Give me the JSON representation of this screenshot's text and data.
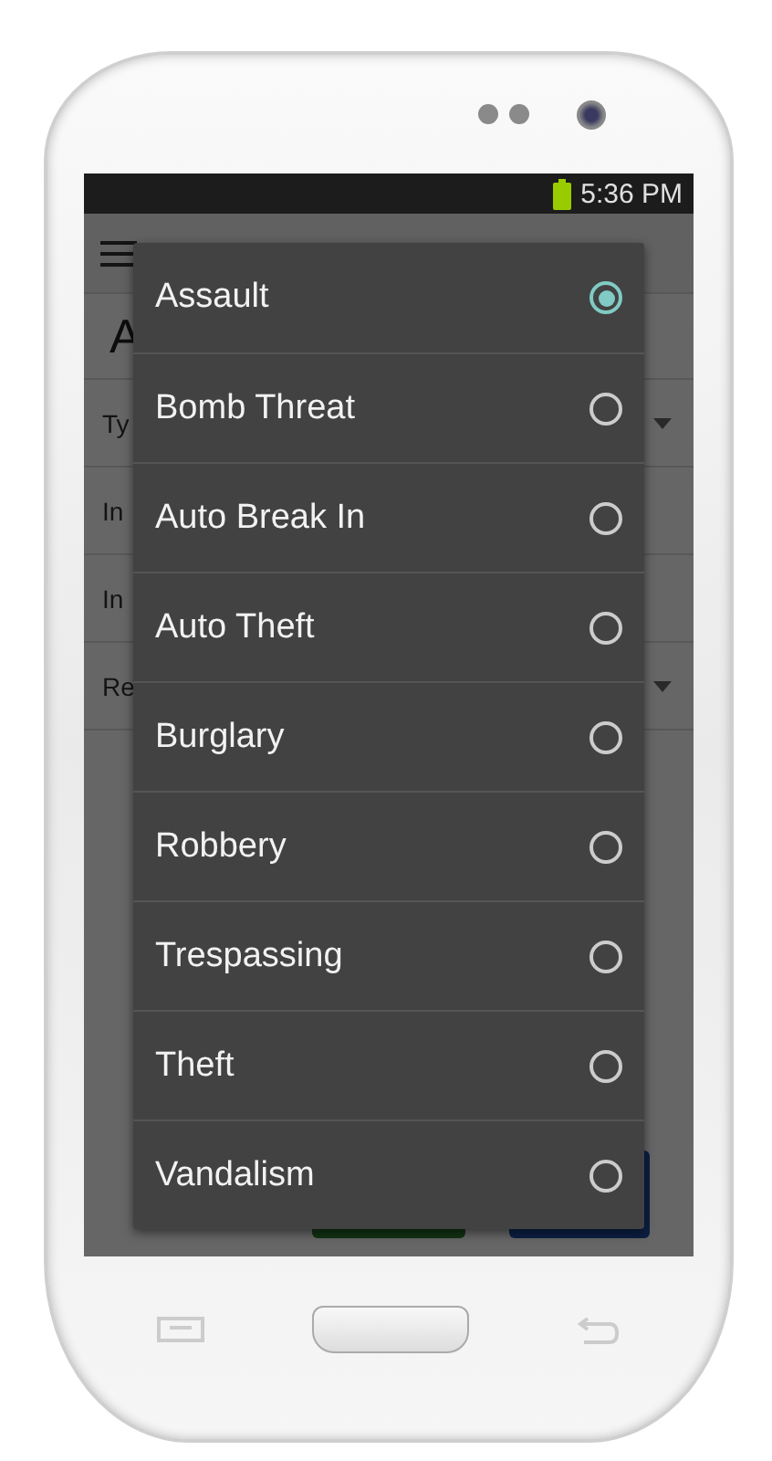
{
  "status_bar": {
    "time": "5:36 PM"
  },
  "form": {
    "heading": "A",
    "fields": [
      {
        "label": "Ty",
        "kind": "dropdown"
      },
      {
        "label": "In",
        "kind": "text"
      },
      {
        "label": "In",
        "kind": "text"
      },
      {
        "label": "Re",
        "kind": "dropdown"
      }
    ]
  },
  "dialog": {
    "options": [
      {
        "label": "Assault",
        "selected": true
      },
      {
        "label": "Bomb Threat",
        "selected": false
      },
      {
        "label": "Auto Break In",
        "selected": false
      },
      {
        "label": "Auto Theft",
        "selected": false
      },
      {
        "label": "Burglary",
        "selected": false
      },
      {
        "label": "Robbery",
        "selected": false
      },
      {
        "label": "Trespassing",
        "selected": false
      },
      {
        "label": "Theft",
        "selected": false
      },
      {
        "label": "Vandalism",
        "selected": false
      }
    ]
  }
}
